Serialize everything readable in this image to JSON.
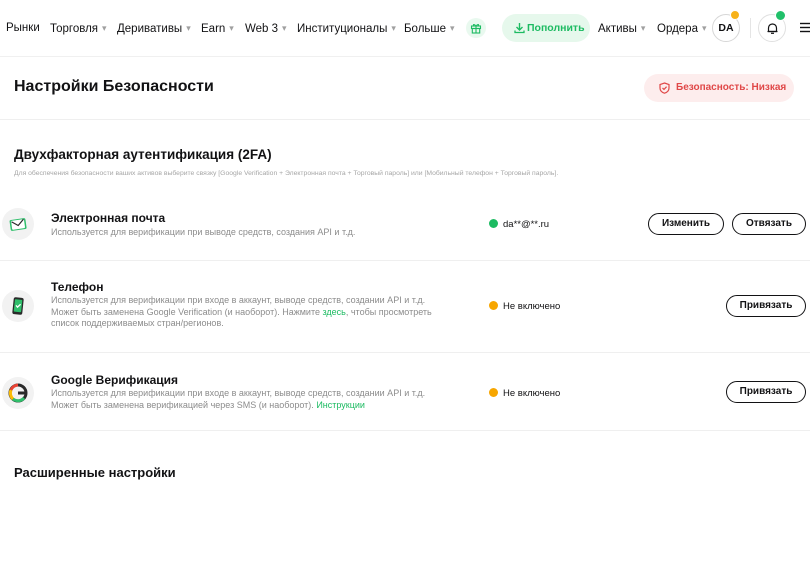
{
  "nav": {
    "items": [
      {
        "label": "Рынки",
        "dropdown": false
      },
      {
        "label": "Торговля",
        "dropdown": true
      },
      {
        "label": "Деривативы",
        "dropdown": true
      },
      {
        "label": "Earn",
        "dropdown": true
      },
      {
        "label": "Web 3",
        "dropdown": true
      },
      {
        "label": "Институционалы",
        "dropdown": true
      },
      {
        "label": "Больше",
        "dropdown": true
      }
    ],
    "gift_icon": "gift-icon",
    "deposit_label": "Пополнить",
    "assets_label": "Активы",
    "orders_label": "Ордера",
    "avatar_initials": "DA",
    "bell_icon": "bell-icon",
    "menu_icon": "hamburger-icon"
  },
  "header": {
    "title": "Настройки Безопасности",
    "security_badge": "Безопасность: Низкая"
  },
  "twofa": {
    "title": "Двухфакторная аутентификация (2FA)",
    "description": "Для обеспечения безопасности ваших активов выберите связку [Google Verification + Электронная почта + Торговый пароль] или [Мобильный телефон + Торговый пароль].",
    "rows": [
      {
        "title": "Электронная почта",
        "description": "Используется для верификации при выводе средств, создания API и т.д.",
        "status": "da**@**.ru",
        "status_kind": "ok",
        "buttons": [
          "Изменить",
          "Отвязать"
        ]
      },
      {
        "title": "Телефон",
        "description_before": "Используется для верификации при входе в аккаунт, выводе средств, создании API и т.д. Может быть заменена Google Verification (и наоборот). Нажмите ",
        "description_link": "здесь",
        "description_after": ", чтобы просмотреть список поддерживаемых стран/регионов.",
        "status": "Не включено",
        "status_kind": "warn",
        "buttons": [
          "Привязать"
        ]
      },
      {
        "title": "Google Верификация",
        "description_before": "Используется для верификации при входе в аккаунт, выводе средств, создании API и т.д. Может быть заменена верификацией через SMS (и наоборот). ",
        "description_link": "Инструкции",
        "status": "Не включено",
        "status_kind": "warn",
        "buttons": [
          "Привязать"
        ]
      }
    ]
  },
  "advanced": {
    "title": "Расширенные настройки"
  },
  "colors": {
    "accent_green": "#1dbb62",
    "warning_orange": "#f7a600",
    "danger_red": "#e04848"
  }
}
